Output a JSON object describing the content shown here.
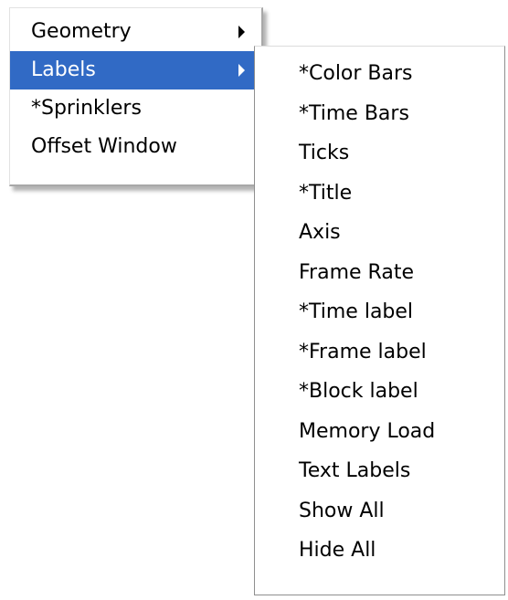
{
  "main_menu": {
    "items": [
      {
        "label": "Geometry",
        "has_submenu": true
      },
      {
        "label": "Labels",
        "has_submenu": true,
        "selected": true
      },
      {
        "label": "*Sprinklers"
      },
      {
        "label": "Offset Window"
      }
    ]
  },
  "labels_submenu": {
    "items": [
      {
        "label": "*Color Bars"
      },
      {
        "label": "*Time Bars"
      },
      {
        "label": "Ticks"
      },
      {
        "label": "*Title"
      },
      {
        "label": "Axis"
      },
      {
        "label": "Frame Rate"
      },
      {
        "label": "*Time label"
      },
      {
        "label": "*Frame label"
      },
      {
        "label": "*Block label"
      },
      {
        "label": "Memory Load"
      },
      {
        "label": "Text Labels"
      },
      {
        "label": "Show All"
      },
      {
        "label": "Hide All"
      }
    ]
  },
  "colors": {
    "selection_bg": "#316ac5",
    "selection_text": "#ffffff",
    "menu_bg": "#ffffff",
    "text": "#000000"
  },
  "icons": {
    "submenu_arrow": "submenu-arrow-icon"
  }
}
